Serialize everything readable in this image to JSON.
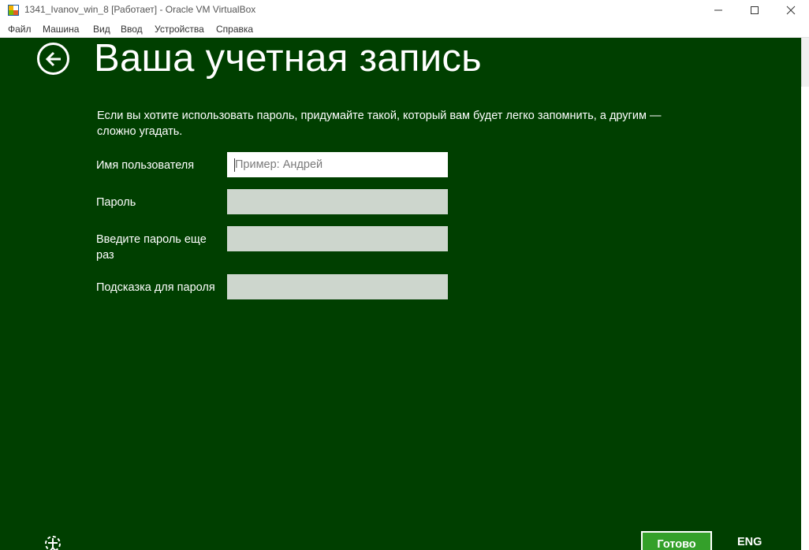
{
  "window": {
    "title": "1341_Ivanov_win_8 [Работает] - Oracle VM VirtualBox",
    "icon": "virtualbox-icon",
    "controls": [
      "minimize-icon",
      "maximize-icon",
      "close-icon"
    ]
  },
  "menubar": {
    "items": [
      "Файл",
      "Машина",
      "Вид",
      "Ввод",
      "Устройства",
      "Справка"
    ]
  },
  "setup": {
    "background_color": "#003f00",
    "title": "Ваша учетная запись",
    "back_icon": "back-arrow-icon",
    "description": "Если вы хотите использовать пароль, придумайте такой, который вам будет легко запомнить, а другим — сложно угадать.",
    "fields": {
      "username": {
        "label": "Имя пользователя",
        "placeholder": "Пример: Андрей",
        "value": ""
      },
      "password": {
        "label": "Пароль",
        "value": ""
      },
      "password_confirm": {
        "label": "Введите пароль еще раз",
        "value": ""
      },
      "password_hint": {
        "label": "Подсказка для пароля",
        "value": ""
      }
    },
    "accessibility_icon": "ease-of-access-icon",
    "done_label": "Готово",
    "done_color": "#34a02a",
    "language": "ENG"
  }
}
